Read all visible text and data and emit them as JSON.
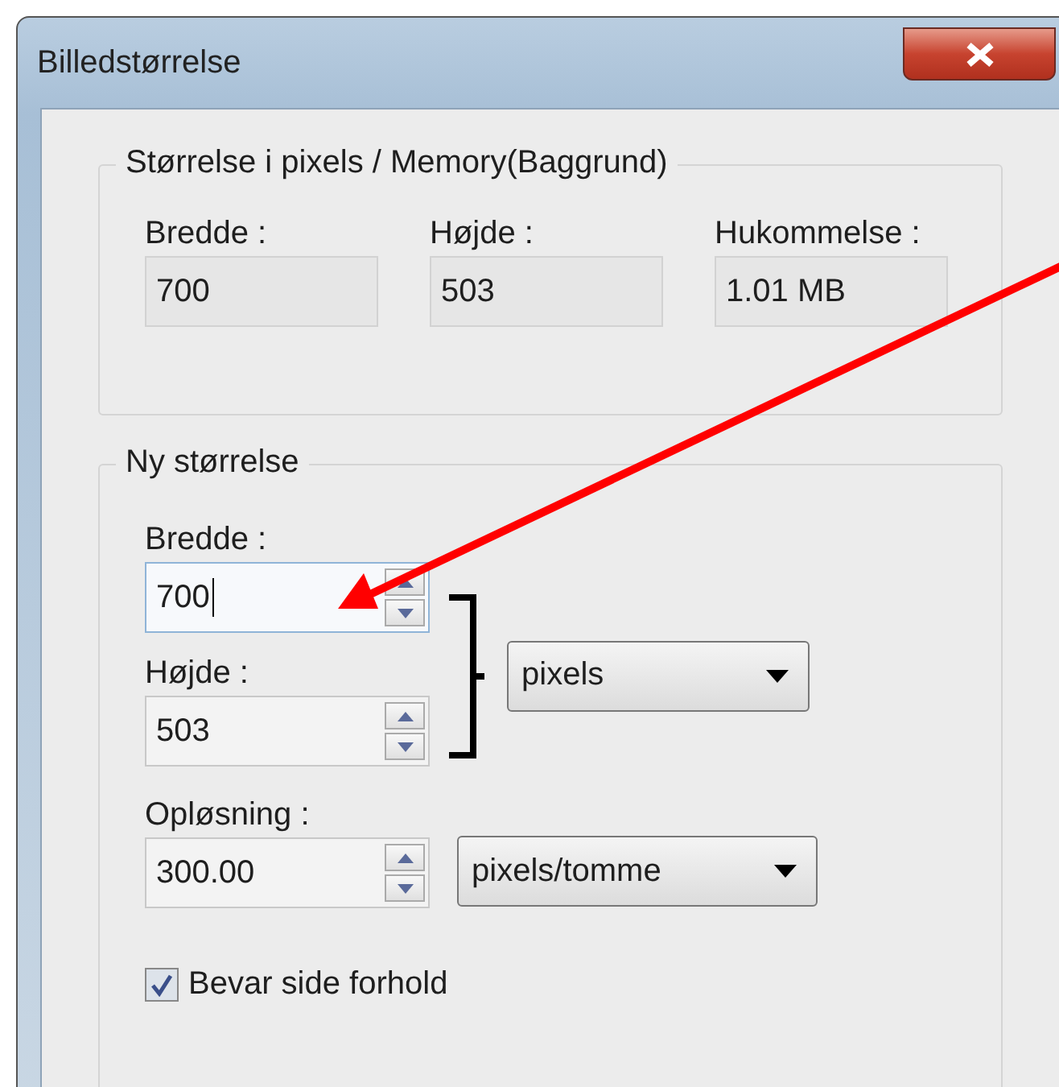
{
  "window": {
    "title": "Billedstørrelse"
  },
  "current_size": {
    "legend": "Størrelse i pixels / Memory(Baggrund)",
    "fields": [
      {
        "label": "Bredde :",
        "value": "700"
      },
      {
        "label": "Højde :",
        "value": "503"
      },
      {
        "label": "Hukommelse :",
        "value": "1.01 MB"
      }
    ]
  },
  "new_size": {
    "legend": "Ny størrelse",
    "width": {
      "label": "Bredde :",
      "value": "700",
      "focused": true
    },
    "height": {
      "label": "Højde :",
      "value": "503",
      "focused": false
    },
    "unit": "pixels",
    "resolution": {
      "label": "Opløsning :",
      "value": "300.00",
      "focused": false
    },
    "resolution_unit": "pixels/tomme",
    "keep_ratio": {
      "label": "Bevar side forhold",
      "checked": true
    }
  }
}
